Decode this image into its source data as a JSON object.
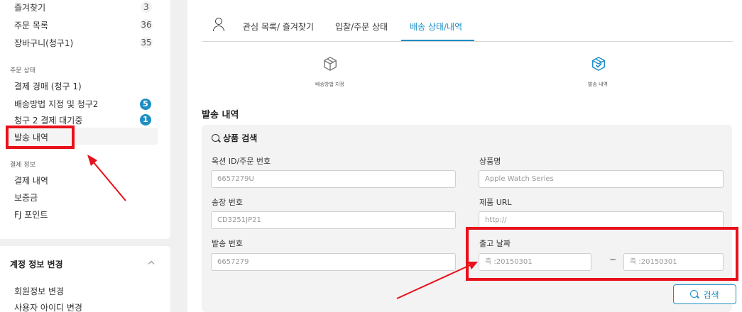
{
  "sidebar": {
    "top_items": [
      {
        "label": "즐겨찾기",
        "count": "3"
      },
      {
        "label": "주문 목록",
        "count": "36"
      },
      {
        "label": "장바구니(청구1)",
        "count": "35"
      }
    ],
    "order_status_heading": "주문 상태",
    "order_items": [
      {
        "label": "결제 경매 (청구 1)"
      },
      {
        "label": "배송방법 지정 및 청구2",
        "badge": "5"
      },
      {
        "label": "청구 2 결제 대기중",
        "badge": "1"
      },
      {
        "label": "발송 내역"
      }
    ],
    "payment_heading": "결제 정보",
    "payment_items": [
      {
        "label": "결제 내역"
      },
      {
        "label": "보증금"
      },
      {
        "label": "FJ 포인트"
      }
    ],
    "account_heading": "계정 정보 변경",
    "account_items": [
      {
        "label": "회원정보 변경"
      },
      {
        "label": "사용자 아이디 변경"
      }
    ]
  },
  "tabs": [
    {
      "label": "관심 목록/ 즐겨찾기"
    },
    {
      "label": "입찰/주문 상태"
    },
    {
      "label": "배송 상태/내역",
      "active": true
    }
  ],
  "steps": [
    {
      "label": "배송방법 지정",
      "icon": "box-icon"
    },
    {
      "label": "발송 내역",
      "icon": "box-check-icon"
    }
  ],
  "section_title": "발송 내역",
  "search": {
    "heading": "상품 검색",
    "fields": {
      "auction_id": {
        "label": "옥션 ID/주문 번호",
        "value": "6657279U"
      },
      "product_name": {
        "label": "상품명",
        "value": "Apple Watch Series"
      },
      "invoice_no": {
        "label": "송장 번호",
        "value": "CD3251JP21"
      },
      "product_url": {
        "label": "제품 URL",
        "value": "http://"
      },
      "shipment_no": {
        "label": "발송 번호",
        "value": "6657279"
      },
      "ship_date": {
        "label": "출고 날짜",
        "from": "즉 :20150301",
        "separator": "~",
        "to": "즉 :20150301"
      }
    },
    "button_label": "검색"
  },
  "colors": {
    "accent": "#1d8ec5",
    "annotation": "#e8101a"
  }
}
